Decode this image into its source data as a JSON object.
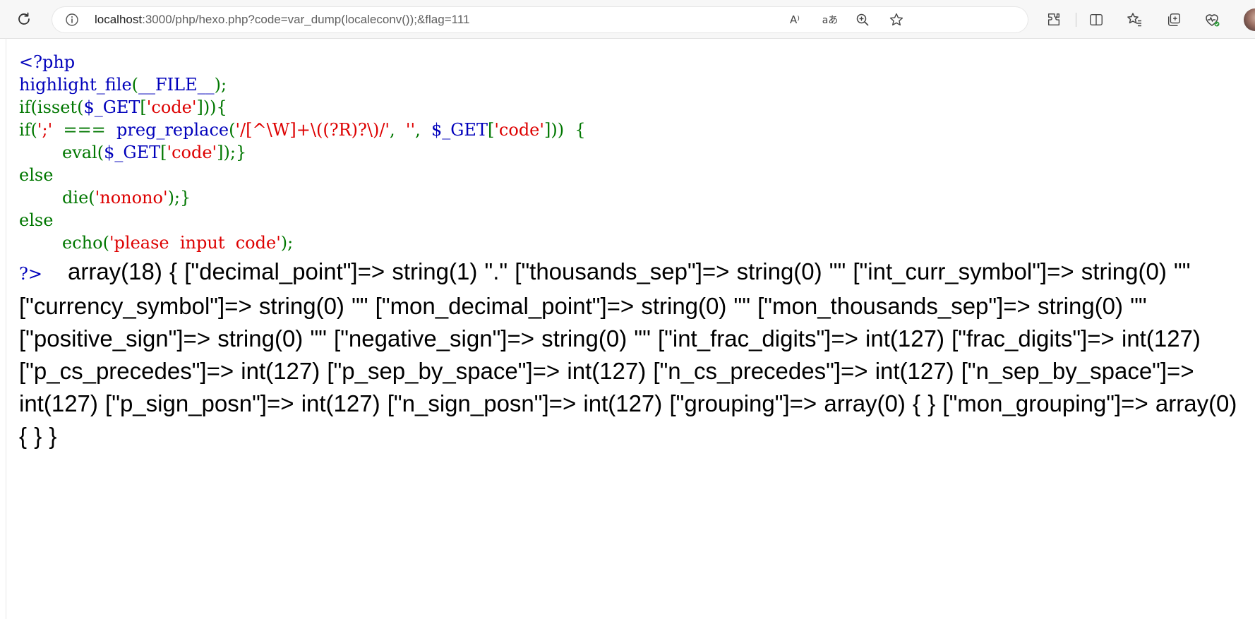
{
  "browser": {
    "url_host": "localhost",
    "url_rest": ":3000/php/hexo.php?code=var_dump(localeconv());&flag=111",
    "icons": {
      "reload": "reload-icon",
      "info": "info-icon",
      "read_aloud": "read-aloud-icon",
      "translate": "translate-icon",
      "zoom": "zoom-icon",
      "favorite": "star-icon",
      "extensions": "extensions-icon",
      "split_screen": "split-screen-icon",
      "favorites": "favorites-icon",
      "collections": "collections-icon",
      "health": "browser-essentials-icon",
      "profile": "avatar"
    },
    "read_aloud_glyph": "A⁾",
    "translate_glyph": "aあ"
  },
  "source_code": {
    "line1": "<?php",
    "line2_fn": "highlight_file",
    "line2_open": "(",
    "line2_const": "__FILE__",
    "line2_close": ");",
    "line3_kw": "if(isset(",
    "line3_var": "$_GET",
    "line3_open": "[",
    "line3_str": "'code'",
    "line3_close": "])){",
    "line4_kw1": "if(",
    "line4_str1": "';'",
    "line4_op": "  ===  ",
    "line4_fn": "preg_replace",
    "line4_open": "(",
    "line4_str2": "'/[^\\W]+\\((?R)?\\)/'",
    "line4_comma1": ",  ",
    "line4_str3": "''",
    "line4_comma2": ",  ",
    "line4_var": "$_GET",
    "line4_open2": "[",
    "line4_str4": "'code'",
    "line4_close": "]))  {",
    "line5_kw": "eval(",
    "line5_var": "$_GET",
    "line5_open": "[",
    "line5_str": "'code'",
    "line5_close": "]);}",
    "line6": "else",
    "line7_kw": "die(",
    "line7_str": "'nonono'",
    "line7_close": ");}",
    "line8": "else",
    "line9_kw": "echo(",
    "line9_str": "'please  input  code'",
    "line9_close": ");",
    "line10": "?>"
  },
  "output": {
    "text": "array(18) { [\"decimal_point\"]=> string(1) \".\" [\"thousands_sep\"]=> string(0) \"\" [\"int_curr_symbol\"]=> string(0) \"\" [\"currency_symbol\"]=> string(0) \"\" [\"mon_decimal_point\"]=> string(0) \"\" [\"mon_thousands_sep\"]=> string(0) \"\" [\"positive_sign\"]=> string(0) \"\" [\"negative_sign\"]=> string(0) \"\" [\"int_frac_digits\"]=> int(127) [\"frac_digits\"]=> int(127) [\"p_cs_precedes\"]=> int(127) [\"p_sep_by_space\"]=> int(127) [\"n_cs_precedes\"]=> int(127) [\"n_sep_by_space\"]=> int(127) [\"p_sign_posn\"]=> int(127) [\"n_sign_posn\"]=> int(127) [\"grouping\"]=> array(0) { } [\"mon_grouping\"]=> array(0) { } }"
  },
  "colors": {
    "php_default": "#0000bb",
    "php_keyword": "#007700",
    "php_string": "#dd0000"
  }
}
